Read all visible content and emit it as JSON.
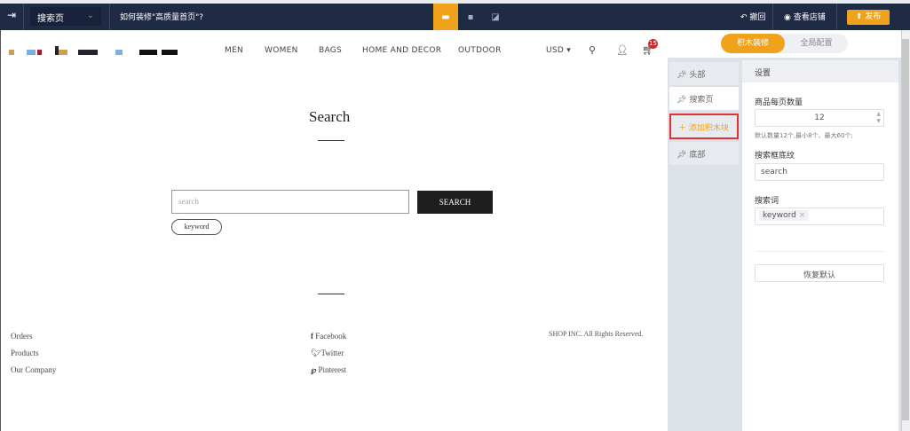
{
  "topbar": {
    "exit_icon": "exit-icon",
    "page_select": "搜索页",
    "help": "如何装修\"高质量首页\"?",
    "undo": "撤回",
    "view_store": "查看店铺",
    "publish": "发布"
  },
  "store": {
    "nav": [
      "MEN",
      "WOMEN",
      "BAGS",
      "HOME AND DECOR",
      "OUTDOOR"
    ],
    "currency": "USD",
    "cart_count": "15",
    "title": "Search",
    "search_placeholder": "search",
    "search_button": "SEARCH",
    "keyword_tag": "keyword",
    "footer": {
      "links": [
        "Orders",
        "Products",
        "Our Company"
      ],
      "social": [
        "Facebook",
        "Twitter",
        "Pinterest"
      ],
      "copyright": "SHOP INC. All Rights Reserved."
    }
  },
  "panel": {
    "tabs": [
      "积木装修",
      "全局配置"
    ],
    "sidebar": [
      "头部",
      "搜索页",
      "添加积木块",
      "底部"
    ],
    "settings_title": "设置",
    "per_page_label": "商品每页数量",
    "per_page_value": "12",
    "per_page_hint": "默认数量12个,最小8个、最大60个;",
    "placeholder_label": "搜索框底纹",
    "placeholder_value": "search",
    "keywords_label": "搜索词",
    "keyword": "keyword",
    "reset": "恢复默认"
  },
  "colors": {
    "accent": "#f0a31a",
    "topbar": "#1f2a44"
  }
}
